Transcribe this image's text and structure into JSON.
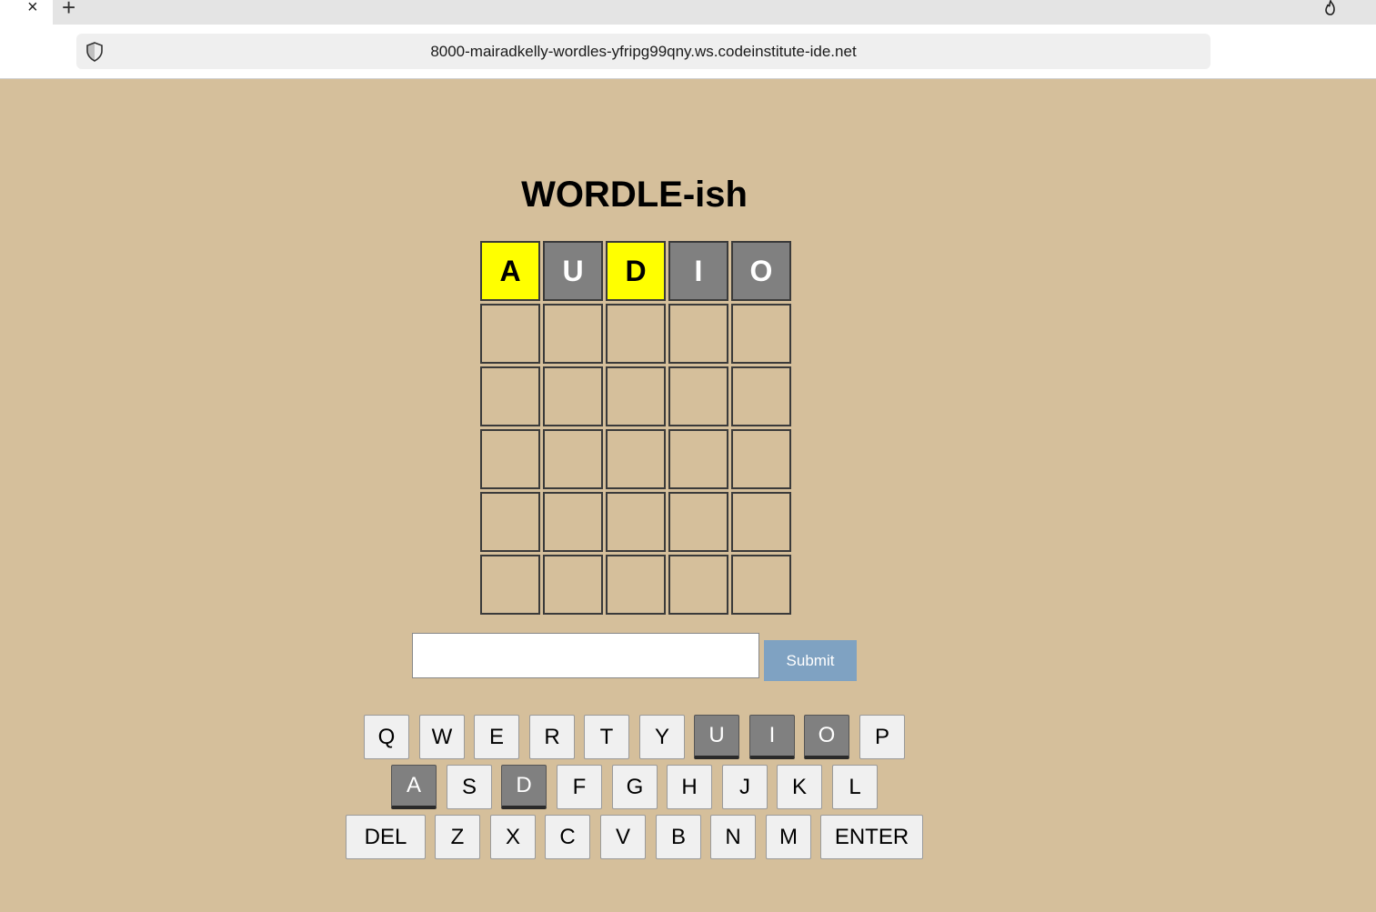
{
  "browser": {
    "tab_close": "×",
    "new_tab": "+",
    "url": "8000-mairadkelly-wordles-yfripg99qny.ws.codeinstitute-ide.net"
  },
  "game": {
    "title": "WORDLE-ish",
    "rows": [
      [
        {
          "letter": "A",
          "state": "yellow"
        },
        {
          "letter": "U",
          "state": "gray"
        },
        {
          "letter": "D",
          "state": "yellow"
        },
        {
          "letter": "I",
          "state": "gray"
        },
        {
          "letter": "O",
          "state": "gray"
        }
      ],
      [
        {
          "letter": "",
          "state": "empty"
        },
        {
          "letter": "",
          "state": "empty"
        },
        {
          "letter": "",
          "state": "empty"
        },
        {
          "letter": "",
          "state": "empty"
        },
        {
          "letter": "",
          "state": "empty"
        }
      ],
      [
        {
          "letter": "",
          "state": "empty"
        },
        {
          "letter": "",
          "state": "empty"
        },
        {
          "letter": "",
          "state": "empty"
        },
        {
          "letter": "",
          "state": "empty"
        },
        {
          "letter": "",
          "state": "empty"
        }
      ],
      [
        {
          "letter": "",
          "state": "empty"
        },
        {
          "letter": "",
          "state": "empty"
        },
        {
          "letter": "",
          "state": "empty"
        },
        {
          "letter": "",
          "state": "empty"
        },
        {
          "letter": "",
          "state": "empty"
        }
      ],
      [
        {
          "letter": "",
          "state": "empty"
        },
        {
          "letter": "",
          "state": "empty"
        },
        {
          "letter": "",
          "state": "empty"
        },
        {
          "letter": "",
          "state": "empty"
        },
        {
          "letter": "",
          "state": "empty"
        }
      ],
      [
        {
          "letter": "",
          "state": "empty"
        },
        {
          "letter": "",
          "state": "empty"
        },
        {
          "letter": "",
          "state": "empty"
        },
        {
          "letter": "",
          "state": "empty"
        },
        {
          "letter": "",
          "state": "empty"
        }
      ]
    ],
    "input_value": "",
    "submit_label": "Submit"
  },
  "keyboard": {
    "rows": [
      [
        {
          "label": "Q",
          "state": "normal"
        },
        {
          "label": "W",
          "state": "normal"
        },
        {
          "label": "E",
          "state": "normal"
        },
        {
          "label": "R",
          "state": "normal"
        },
        {
          "label": "T",
          "state": "normal"
        },
        {
          "label": "Y",
          "state": "normal"
        },
        {
          "label": "U",
          "state": "gray"
        },
        {
          "label": "I",
          "state": "gray"
        },
        {
          "label": "O",
          "state": "gray"
        },
        {
          "label": "P",
          "state": "normal"
        }
      ],
      [
        {
          "label": "A",
          "state": "gray"
        },
        {
          "label": "S",
          "state": "normal"
        },
        {
          "label": "D",
          "state": "gray"
        },
        {
          "label": "F",
          "state": "normal"
        },
        {
          "label": "G",
          "state": "normal"
        },
        {
          "label": "H",
          "state": "normal"
        },
        {
          "label": "J",
          "state": "normal"
        },
        {
          "label": "K",
          "state": "normal"
        },
        {
          "label": "L",
          "state": "normal"
        }
      ],
      [
        {
          "label": "DEL",
          "state": "normal"
        },
        {
          "label": "Z",
          "state": "normal"
        },
        {
          "label": "X",
          "state": "normal"
        },
        {
          "label": "C",
          "state": "normal"
        },
        {
          "label": "V",
          "state": "normal"
        },
        {
          "label": "B",
          "state": "normal"
        },
        {
          "label": "N",
          "state": "normal"
        },
        {
          "label": "M",
          "state": "normal"
        },
        {
          "label": "ENTER",
          "state": "normal"
        }
      ]
    ]
  },
  "colors": {
    "background": "#d5bf9b",
    "present": "#ffff00",
    "absent": "#808080",
    "submit": "#7fa2c2"
  },
  "icons": {
    "shield": "shield-icon",
    "flame": "flame-icon"
  }
}
